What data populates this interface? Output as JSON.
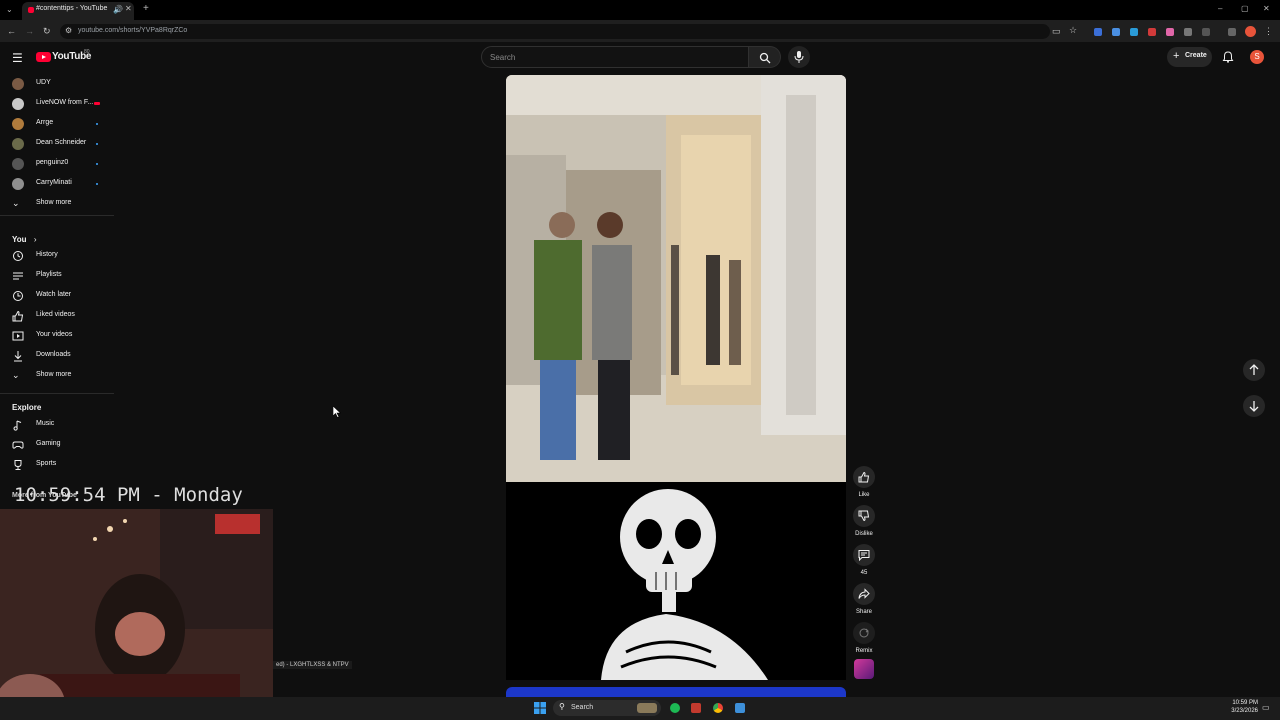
{
  "browser": {
    "tab_title": "#contenttips - YouTube",
    "new_tab_icon": "plus-icon",
    "url": "youtube.com/shorts/YVPa8RqrZCo"
  },
  "header": {
    "logo_text": "YouTube",
    "logo_sup": "80",
    "search_placeholder": "Search",
    "create_label": "Create",
    "avatar_letter": "S"
  },
  "sidebar": {
    "subscriptions": [
      {
        "label": "UDY",
        "dot": false,
        "live": false,
        "color": "#7a5a44"
      },
      {
        "label": "LiveNOW from F...",
        "dot": false,
        "live": true,
        "color": "#c8c8c8"
      },
      {
        "label": "Arrge",
        "dot": true,
        "live": false,
        "color": "#b07b3c"
      },
      {
        "label": "Dean Schneider",
        "dot": true,
        "live": false,
        "color": "#6a6a4a"
      },
      {
        "label": "penguinz0",
        "dot": true,
        "live": false,
        "color": "#555555"
      },
      {
        "label": "CarryMinati",
        "dot": true,
        "live": false,
        "color": "#8f8f8f"
      }
    ],
    "show_more_1": "Show more",
    "you_header": "You",
    "you_items": [
      {
        "label": "History",
        "icon": "history-icon"
      },
      {
        "label": "Playlists",
        "icon": "playlists-icon"
      },
      {
        "label": "Watch later",
        "icon": "watch-later-icon"
      },
      {
        "label": "Liked videos",
        "icon": "liked-icon"
      },
      {
        "label": "Your videos",
        "icon": "your-videos-icon"
      },
      {
        "label": "Downloads",
        "icon": "download-icon"
      }
    ],
    "show_more_2": "Show more",
    "explore_header": "Explore",
    "explore_items": [
      {
        "label": "Music",
        "icon": "music-icon"
      },
      {
        "label": "Gaming",
        "icon": "gaming-icon"
      },
      {
        "label": "Sports",
        "icon": "trophy-icon"
      }
    ],
    "more_from": "More from YouTube"
  },
  "actions": {
    "like_label": "Like",
    "dislike_label": "Dislike",
    "comments_count": "45",
    "share_label": "Share",
    "remix_label": "Remix"
  },
  "overlay": {
    "clock": "10:59:54 PM - Monday",
    "song": "ed) - LXGHTLXSS & NTPV"
  },
  "taskbar": {
    "search_label": "Search",
    "time": "10:59 PM",
    "date": "3/23/2026"
  },
  "colors": {
    "accent": "#ff0033",
    "background": "#0f0f0f",
    "dot": "#3ea6ff"
  }
}
